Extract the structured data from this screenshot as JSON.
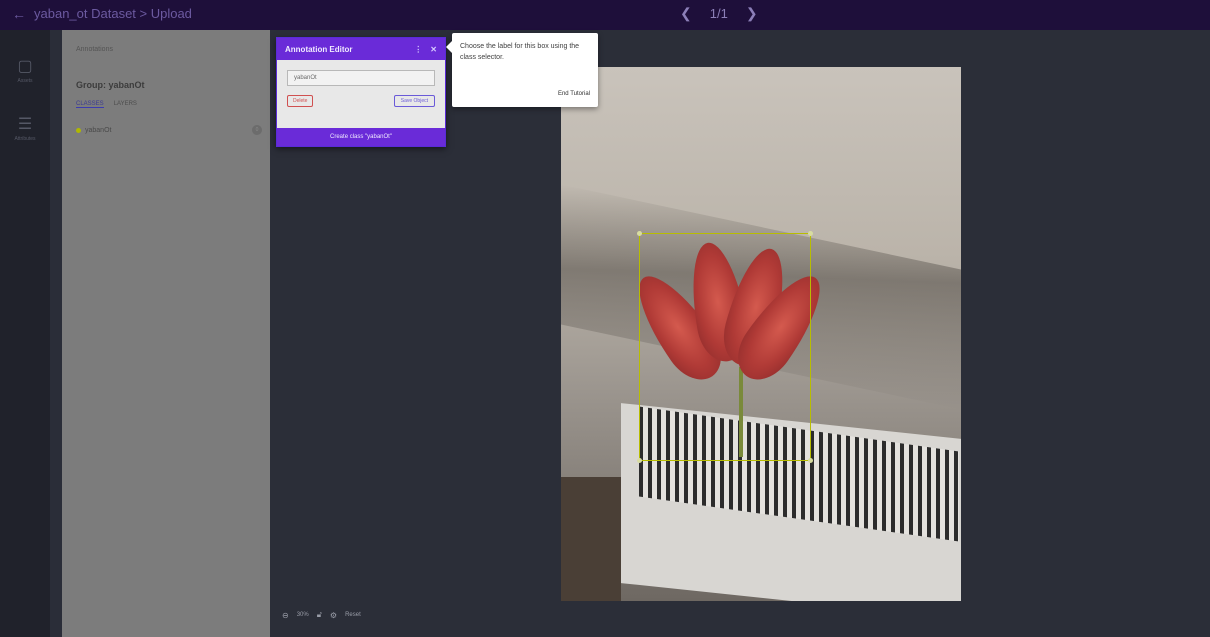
{
  "topbar": {
    "back_icon": "arrow-left-icon",
    "breadcrumb": "yaban_ot Dataset > Upload",
    "pager_text": "1/1",
    "prev_icon": "chevron-left-icon",
    "next_icon": "chevron-right-icon"
  },
  "rail": {
    "items": [
      {
        "icon": "images-icon",
        "label": "Assets"
      },
      {
        "icon": "list-icon",
        "label": "Attributes"
      }
    ]
  },
  "side_panel": {
    "title": "Annotations",
    "group_title": "Group: yabanOt",
    "tabs": [
      "CLASSES",
      "LAYERS"
    ],
    "active_tab": "CLASSES",
    "classes": [
      {
        "name": "yabanOt",
        "count": "0",
        "color": "#b0b800"
      }
    ]
  },
  "editor": {
    "title": "Annotation Editor",
    "menu_icon": "more-vert-icon",
    "close_icon": "close-icon",
    "input_value": "yabanOt",
    "delete_label": "Delete",
    "save_label": "Save Object",
    "create_label": "Create class \"yabanOt\""
  },
  "tooltip": {
    "text": "Choose the label for this box using the class selector.",
    "end_label": "End Tutorial"
  },
  "bottom_toolbar": {
    "zoom_text": "30%",
    "reset_label": "Reset"
  },
  "colors": {
    "topbar": "#1e0f3a",
    "accent": "#6a2bd8",
    "bbox": "#b8bd00"
  }
}
